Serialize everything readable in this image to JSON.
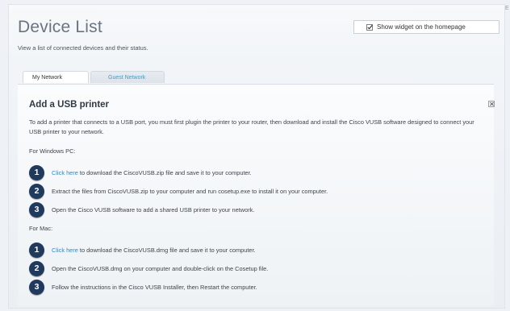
{
  "page": {
    "title": "Device List",
    "subtitle": "View a list of connected devices and their status.",
    "widget_label": "Show widget on the homepage",
    "widget_checked": true,
    "corner_mark": "E"
  },
  "tabs": [
    {
      "label": "My Network",
      "active": true
    },
    {
      "label": "Guest Network",
      "active": false
    }
  ],
  "section": {
    "title": "Add a USB printer",
    "description": "To add a printer that connects to a USB port, you must first plugin the printer to your router, then download and install the Cisco VUSB software designed to connect your USB printer to your network.",
    "windows": {
      "label": "For Windows PC:",
      "steps": [
        {
          "num": "1",
          "link": "Click here",
          "text": " to download the CiscoVUSB.zip file and save it to your computer."
        },
        {
          "num": "2",
          "link": "",
          "text": "Extract the files from CiscoVUSB.zip to your computer and run cosetup.exe to install it on your computer."
        },
        {
          "num": "3",
          "link": "",
          "text": "Open the Cisco VUSB software to add a shared USB printer to your network."
        }
      ]
    },
    "mac": {
      "label": "For Mac:",
      "steps": [
        {
          "num": "1",
          "link": "Click here",
          "text": " to download the CiscoVUSB.dmg file and save it to your computer."
        },
        {
          "num": "2",
          "link": "",
          "text": "Open the CiscoVUSB.dmg on your computer and double-click on the Cosetup file."
        },
        {
          "num": "3",
          "link": "",
          "text": "Follow the instructions in the Cisco VUSB Installer, then Restart the computer."
        }
      ]
    }
  }
}
